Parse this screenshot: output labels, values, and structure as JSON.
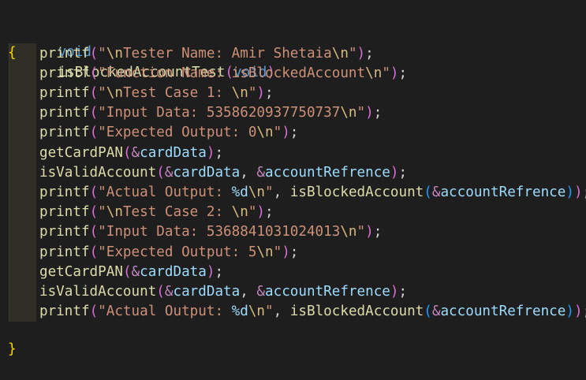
{
  "editor": {
    "function_signature": {
      "return_type": "void",
      "name": "isBlockedAccountTest",
      "param_type": "void"
    },
    "open_brace": "{",
    "close_brace": "}",
    "body": [
      {
        "kind": "printf",
        "fn": "printf",
        "segments": [
          {
            "t": "str",
            "v": "\""
          },
          {
            "t": "esc",
            "v": "\\n"
          },
          {
            "t": "str",
            "v": "Tester Name: Amir Shetaia"
          },
          {
            "t": "esc",
            "v": "\\n"
          },
          {
            "t": "str",
            "v": "\""
          }
        ]
      },
      {
        "kind": "printf",
        "fn": "printf",
        "segments": [
          {
            "t": "str",
            "v": "\"Function Name: isBlockedAccount"
          },
          {
            "t": "esc",
            "v": "\\n"
          },
          {
            "t": "str",
            "v": "\""
          }
        ]
      },
      {
        "kind": "printf",
        "fn": "printf",
        "segments": [
          {
            "t": "str",
            "v": "\""
          },
          {
            "t": "esc",
            "v": "\\n"
          },
          {
            "t": "str",
            "v": "Test Case 1: "
          },
          {
            "t": "esc",
            "v": "\\n"
          },
          {
            "t": "str",
            "v": "\""
          }
        ]
      },
      {
        "kind": "printf",
        "fn": "printf",
        "segments": [
          {
            "t": "str",
            "v": "\"Input Data: 5358620937750737"
          },
          {
            "t": "esc",
            "v": "\\n"
          },
          {
            "t": "str",
            "v": "\""
          }
        ]
      },
      {
        "kind": "printf",
        "fn": "printf",
        "segments": [
          {
            "t": "str",
            "v": "\"Expected Output: 0"
          },
          {
            "t": "esc",
            "v": "\\n"
          },
          {
            "t": "str",
            "v": "\""
          }
        ]
      },
      {
        "kind": "call1",
        "fn": "getCardPAN",
        "arg": "cardData"
      },
      {
        "kind": "call2",
        "fn": "isValidAccount",
        "arg1": "cardData",
        "arg2": "accountRefrence"
      },
      {
        "kind": "printf_call",
        "fn": "printf",
        "str_pre": "\"Actual Output: ",
        "fmt": "%d",
        "esc": "\\n",
        "str_post": "\"",
        "inner_fn": "isBlockedAccount",
        "inner_arg": "accountRefrence"
      },
      {
        "kind": "printf",
        "fn": "printf",
        "segments": [
          {
            "t": "str",
            "v": "\""
          },
          {
            "t": "esc",
            "v": "\\n"
          },
          {
            "t": "str",
            "v": "Test Case 2: "
          },
          {
            "t": "esc",
            "v": "\\n"
          },
          {
            "t": "str",
            "v": "\""
          }
        ]
      },
      {
        "kind": "printf",
        "fn": "printf",
        "segments": [
          {
            "t": "str",
            "v": "\"Input Data: 5368841031024013"
          },
          {
            "t": "esc",
            "v": "\\n"
          },
          {
            "t": "str",
            "v": "\""
          }
        ]
      },
      {
        "kind": "printf",
        "fn": "printf",
        "segments": [
          {
            "t": "str",
            "v": "\"Expected Output: 5"
          },
          {
            "t": "esc",
            "v": "\\n"
          },
          {
            "t": "str",
            "v": "\""
          }
        ]
      },
      {
        "kind": "call1",
        "fn": "getCardPAN",
        "arg": "cardData"
      },
      {
        "kind": "call2",
        "fn": "isValidAccount",
        "arg1": "cardData",
        "arg2": "accountRefrence"
      },
      {
        "kind": "printf_call",
        "fn": "printf",
        "str_pre": "\"Actual Output: ",
        "fmt": "%d",
        "esc": "\\n",
        "str_post": "\"",
        "inner_fn": "isBlockedAccount",
        "inner_arg": "accountRefrence"
      }
    ]
  }
}
